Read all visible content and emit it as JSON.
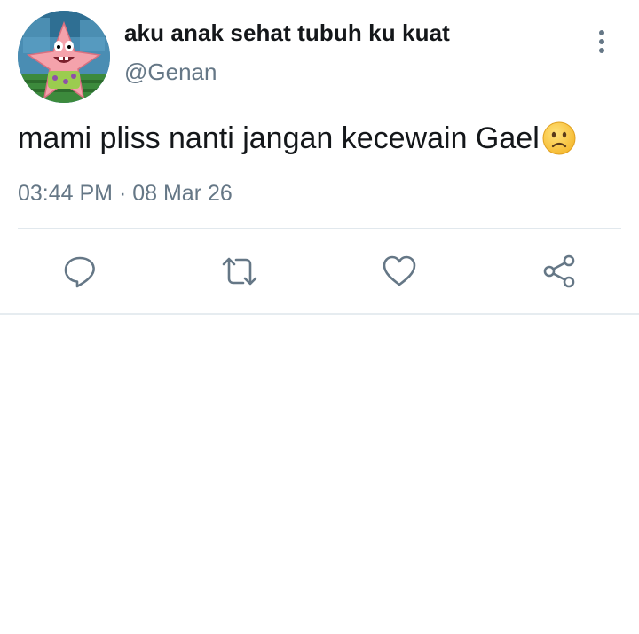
{
  "author": {
    "display_name": "aku anak sehat tubuh ku kuat",
    "handle": "@Genan",
    "avatar": "patrick-star-avatar"
  },
  "tweet": {
    "text": "mami pliss nanti jangan kecewain Gael",
    "emoji": "slightly-frowning-face",
    "timestamp": "03:44 PM · 08 Mar 26"
  },
  "actions": [
    {
      "name": "reply",
      "icon": "reply-icon"
    },
    {
      "name": "retweet",
      "icon": "retweet-icon"
    },
    {
      "name": "like",
      "icon": "heart-icon"
    },
    {
      "name": "share",
      "icon": "share-icon"
    }
  ],
  "colors": {
    "text_primary": "#14171a",
    "text_secondary": "#657786",
    "divider": "#e1e8ed"
  }
}
